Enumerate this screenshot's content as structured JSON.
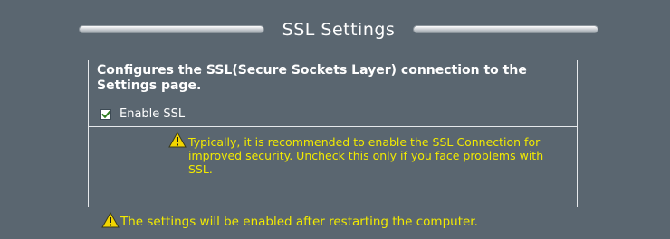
{
  "section": {
    "title": "SSL Settings"
  },
  "ssl": {
    "description": "Configures the SSL(Secure Sockets Layer) connection to the Settings page.",
    "enable_label": "Enable SSL",
    "enabled": true,
    "recommendation": "Typically, it is recommended to enable the SSL Connection for improved security. Uncheck this only if you face problems with SSL."
  },
  "footer": {
    "notice": "The settings will be enabled after restarting the computer."
  },
  "colors": {
    "background": "#5a6670",
    "text": "#ffffff",
    "warning_text": "#f2ea00",
    "warning_icon": "#f2d600",
    "checkmark": "#2e7d1f"
  },
  "icons": {
    "check": "checkmark-icon",
    "warning": "warning-triangle-icon"
  }
}
